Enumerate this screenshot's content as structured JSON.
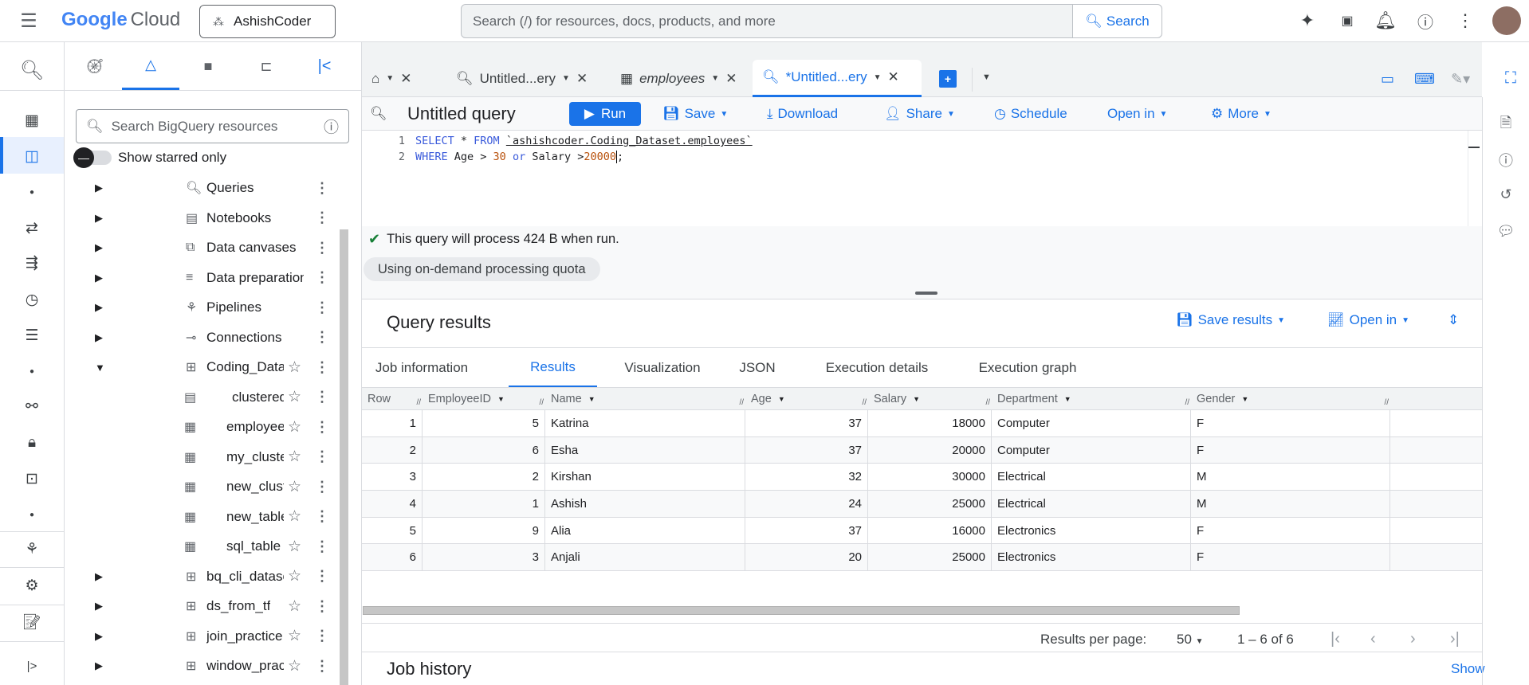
{
  "header": {
    "logo_google": "Google",
    "logo_cloud": "Cloud",
    "project": "AshishCoder",
    "search_placeholder": "Search (/) for resources, docs, products, and more",
    "search_button": "Search"
  },
  "explorer": {
    "search_placeholder": "Search BigQuery resources",
    "starred_toggle": "Show starred only",
    "items": [
      {
        "label": "Queries",
        "icon": "query-icon"
      },
      {
        "label": "Notebooks",
        "icon": "notebook-icon"
      },
      {
        "label": "Data canvases",
        "icon": "canvas-icon"
      },
      {
        "label": "Data preparations",
        "icon": "data-prep-icon"
      },
      {
        "label": "Pipelines",
        "icon": "pipeline-icon"
      },
      {
        "label": "Connections",
        "icon": "connection-icon"
      },
      {
        "label": "Coding_Dataset",
        "icon": "dataset-icon",
        "expanded": true
      },
      {
        "label": "clustered_table",
        "icon": "clustered-table-icon",
        "child": true
      },
      {
        "label": "employees",
        "icon": "table-icon",
        "child": true
      },
      {
        "label": "my_clustered_table",
        "icon": "table-icon",
        "child": true
      },
      {
        "label": "new_clustered_table",
        "icon": "table-icon",
        "child": true
      },
      {
        "label": "new_table",
        "icon": "table-icon",
        "child": true
      },
      {
        "label": "sql_table",
        "icon": "table-icon",
        "child": true
      },
      {
        "label": "bq_cli_dataset",
        "icon": "dataset-icon"
      },
      {
        "label": "ds_from_tf",
        "icon": "dataset-icon"
      },
      {
        "label": "join_practice",
        "icon": "dataset-icon"
      },
      {
        "label": "window_practice",
        "icon": "dataset-icon"
      }
    ]
  },
  "tabs": [
    {
      "label": "Untitled...ery"
    },
    {
      "label": "employees"
    },
    {
      "label": "*Untitled...ery",
      "active": true
    }
  ],
  "query": {
    "title": "Untitled query",
    "run": "Run",
    "save": "Save",
    "download": "Download",
    "share": "Share",
    "schedule": "Schedule",
    "open_in": "Open in",
    "more": "More",
    "lines": [
      "1",
      "2"
    ],
    "code": {
      "l1_kw1": "SELECT",
      "l1_star": " * ",
      "l1_kw2": "FROM",
      "l1_str": "`ashishcoder.Coding_Dataset.employees`",
      "l2_kw1": "WHERE",
      "l2_a": " Age > ",
      "l2_n1": "30",
      "l2_kw2": "or",
      "l2_b": " Salary >",
      "l2_n2": "20000",
      "l2_end": ";"
    },
    "info": "This query will process 424 B when run.",
    "quota": "Using on-demand processing quota"
  },
  "results": {
    "title": "Query results",
    "save_results": "Save results",
    "open_in": "Open in",
    "tabs": [
      "Job information",
      "Results",
      "Visualization",
      "JSON",
      "Execution details",
      "Execution graph"
    ],
    "columns": [
      "Row",
      "EmployeeID",
      "Name",
      "Age",
      "Salary",
      "Department",
      "Gender"
    ],
    "rows": [
      [
        "1",
        "5",
        "Katrina",
        "37",
        "18000",
        "Computer",
        "F"
      ],
      [
        "2",
        "6",
        "Esha",
        "37",
        "20000",
        "Computer",
        "F"
      ],
      [
        "3",
        "2",
        "Kirshan",
        "32",
        "30000",
        "Electrical",
        "M"
      ],
      [
        "4",
        "1",
        "Ashish",
        "24",
        "25000",
        "Electrical",
        "M"
      ],
      [
        "5",
        "9",
        "Alia",
        "37",
        "16000",
        "Electronics",
        "F"
      ],
      [
        "6",
        "3",
        "Anjali",
        "20",
        "25000",
        "Electronics",
        "F"
      ]
    ],
    "per_page_label": "Results per page:",
    "per_page": "50",
    "range": "1 – 6 of 6"
  },
  "job_history": {
    "title": "Job history",
    "show": "Show"
  },
  "colors": {
    "accent": "#1a73e8",
    "success": "#188038"
  }
}
